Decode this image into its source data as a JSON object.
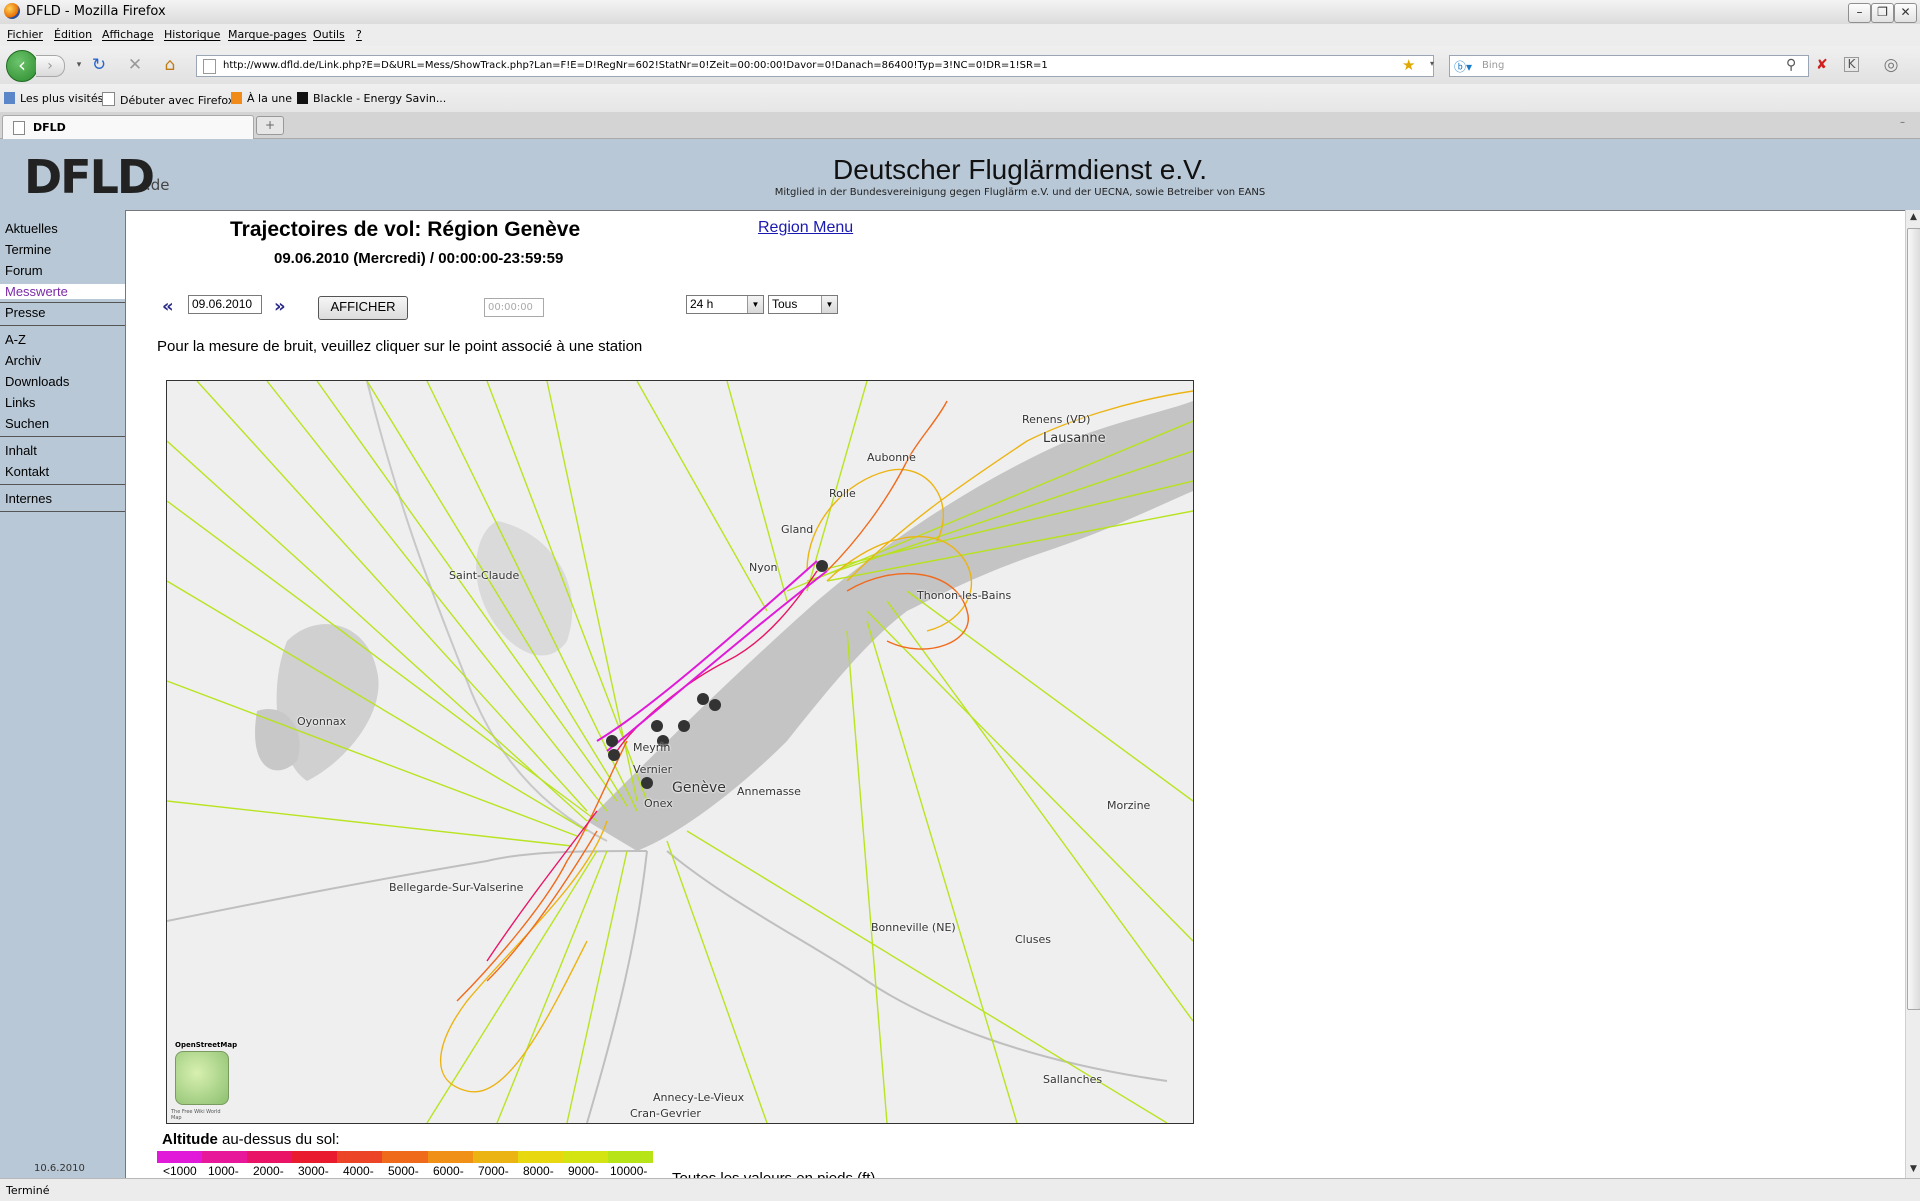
{
  "window": {
    "title": "DFLD - Mozilla Firefox"
  },
  "menu": [
    "Fichier",
    "Édition",
    "Affichage",
    "Historique",
    "Marque-pages",
    "Outils",
    "?"
  ],
  "navbar": {
    "url": "http://www.dfld.de/Link.php?E=D&URL=Mess/ShowTrack.php?Lan=F!E=D!RegNr=602!StatNr=0!Zeit=00:00:00!Davor=0!Danach=86400!Typ=3!NC=0!DR=1!SR=1",
    "search_placeholder": "Bing"
  },
  "bookmarks": [
    "Les plus visités",
    "Débuter avec Firefox",
    "À la une",
    "Blackle - Energy Savin..."
  ],
  "tab": {
    "label": "DFLD"
  },
  "header": {
    "logo": "DFLD",
    "logo_suffix": ".de",
    "title": "Deutscher Fluglärmdienst e.V.",
    "subtitle": "Mitglied in der Bundesvereinigung gegen Fluglärm e.V. und der UECNA, sowie Betreiber von EANS"
  },
  "sidebar": {
    "items": [
      "Aktuelles",
      "Termine",
      "Forum",
      "Messwerte",
      "Presse",
      "A-Z",
      "Archiv",
      "Downloads",
      "Links",
      "Suchen",
      "Inhalt",
      "Kontakt",
      "Internes"
    ],
    "active": "Messwerte",
    "date": "10.6.2010"
  },
  "main": {
    "title": "Trajectoires de vol: Région Genève",
    "date_line": "09.06.2010 (Mercredi) / 00:00:00-23:59:59",
    "region_link": "Region Menu",
    "date_value": "09.06.2010",
    "afficher": "AFFICHER",
    "time_placeholder": "00:00:00",
    "range_value": "24 h",
    "filter_value": "Tous",
    "instruction": "Pour la mesure de bruit, veuillez cliquer sur le point associé à une station"
  },
  "map": {
    "places": [
      "Renens (VD)",
      "Lausanne",
      "Aubonne",
      "Rolle",
      "Gland",
      "Nyon",
      "Thonon-les-Bains",
      "Saint-Claude",
      "Oyonnax",
      "Meyrin",
      "Vernier",
      "Genève",
      "Onex",
      "Annemasse",
      "Bellegarde-Sur-Valserine",
      "Bonneville (NE)",
      "Cluses",
      "Morzine",
      "Sallanches",
      "Annecy-Le-Vieux",
      "Cran-Gevrier"
    ],
    "osm_label": "OpenStreetMap",
    "osm_caption": "The Free Wiki World Map"
  },
  "legend": {
    "title_bold": "Altitude",
    "title_rest": " au-dessus du sol:",
    "colors": [
      "#e01ad8",
      "#e8189a",
      "#ea1466",
      "#e81c2e",
      "#ec4426",
      "#f06a1c",
      "#f09016",
      "#ecb412",
      "#e8d810",
      "#d4e412",
      "#b6e416"
    ],
    "ticks": [
      "<1000",
      "1000-",
      "2000-",
      "3000-",
      "4000-",
      "5000-",
      "6000-",
      "7000-",
      "8000-",
      "9000-",
      "10000-"
    ],
    "note": "Toutes les valeurs en pieds (ft)"
  },
  "status": {
    "text": "Terminé"
  }
}
